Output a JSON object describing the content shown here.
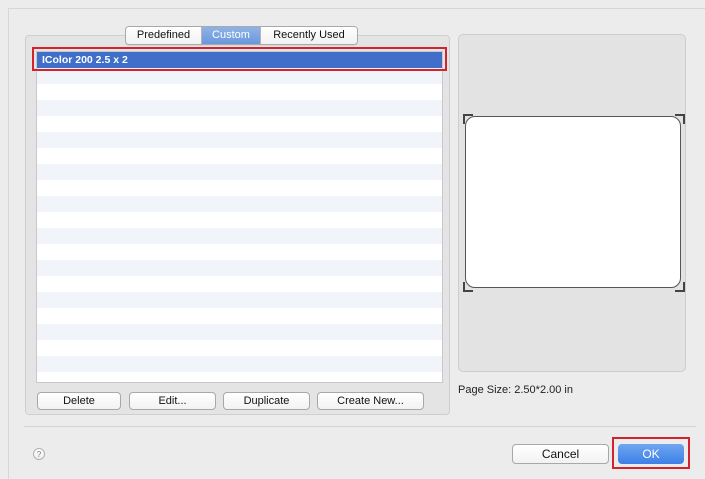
{
  "tabs": [
    {
      "label": "Predefined",
      "selected": false
    },
    {
      "label": "Custom",
      "selected": true
    },
    {
      "label": "Recently Used",
      "selected": false
    }
  ],
  "list": {
    "items": [
      "IColor 200 2.5 x 2"
    ],
    "selected_index": 0
  },
  "actions": {
    "delete": "Delete",
    "edit": "Edit...",
    "duplicate": "Duplicate",
    "create_new": "Create New..."
  },
  "preview": {
    "page_size_text": "Page Size: 2.50*2.00 in"
  },
  "help": {
    "glyph": "?"
  },
  "footer": {
    "cancel": "Cancel",
    "ok": "OK"
  },
  "colors": {
    "selection": "#3f6fc9",
    "ok_button": "#3c7fe6",
    "highlight_outline": "#d3232f"
  }
}
